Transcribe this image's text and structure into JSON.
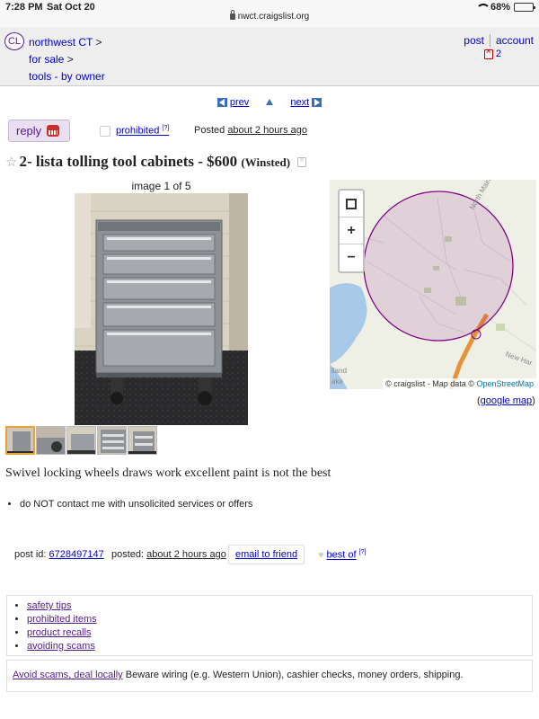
{
  "status_bar": {
    "time": "7:28 PM",
    "date": "Sat Oct 20",
    "battery": "68%",
    "battery_level": 0.68
  },
  "browser": {
    "url": "nwct.craigslist.org"
  },
  "header": {
    "logo": "CL",
    "breadcrumbs": [
      "northwest CT",
      "for sale",
      "tools - by owner"
    ],
    "breadcrumb_sep": ">",
    "post_label": "post",
    "account_label": "account",
    "favorites_count": "2"
  },
  "pager": {
    "prev_label": "prev",
    "next_label": "next"
  },
  "actions": {
    "reply_label": "reply",
    "flag_label": "prohibited",
    "flag_help": "[?]",
    "posted_prefix": "Posted",
    "posted_ago": "about 2 hours ago"
  },
  "posting": {
    "title": "2- lista tolling tool cabinets - $600",
    "location": "(Winsted)",
    "image_caption": "image 1 of 5",
    "body": "Swivel locking wheels draws work excellent paint is not the best",
    "notices": [
      "do NOT contact me with unsolicited services or offers"
    ]
  },
  "map": {
    "zoom_in": "+",
    "zoom_out": "−",
    "attribution_prefix": "© craigslist - Map data ©",
    "attribution_link": "OpenStreetMap",
    "google_map_label": "google map",
    "labels": [
      "North Main S",
      "New Har",
      "lland",
      "ake"
    ]
  },
  "post_info": {
    "post_id_label": "post id:",
    "post_id": "6728497147",
    "posted_label": "posted:",
    "posted_ago": "about 2 hours ago",
    "email_friend": "email to friend",
    "best_of": "best of",
    "best_of_help": "[?]"
  },
  "safety_links": [
    "safety tips",
    "prohibited items",
    "product recalls",
    "avoiding scams"
  ],
  "scam_warning": {
    "link": "Avoid scams, deal locally",
    "text": " Beware wiring (e.g. Western Union), cashier checks, money orders, shipping."
  },
  "colors": {
    "visited_link": "#551a8b",
    "link": "#0000cc",
    "reply_bg": "#eadff0",
    "map_circle": "#800080"
  }
}
